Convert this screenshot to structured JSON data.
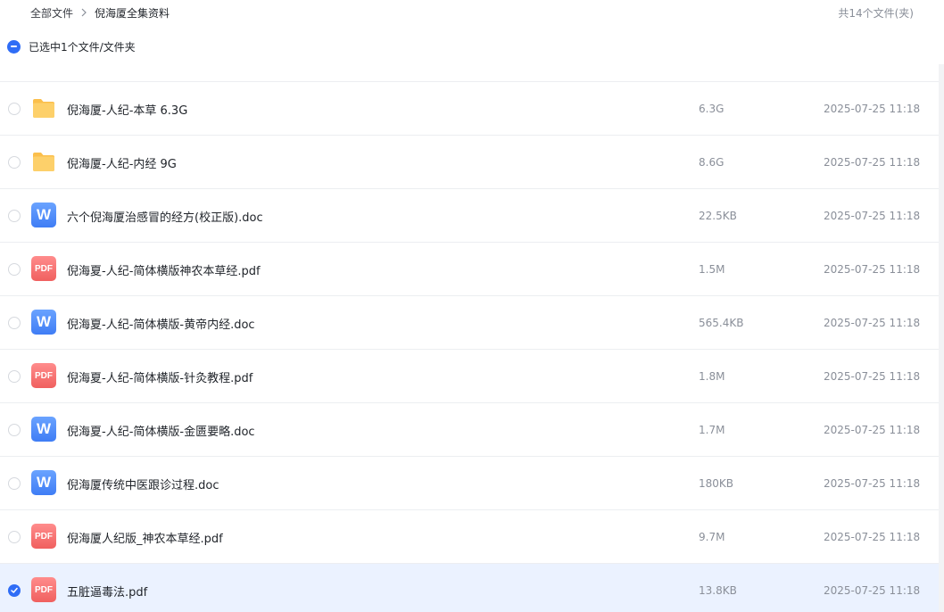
{
  "header": {
    "breadcrumb_root": "全部文件",
    "breadcrumb_current": "倪海厦全集资料",
    "file_count": "共14个文件(夹)",
    "selected_text": "已选中1个文件/文件夹"
  },
  "files": [
    {
      "type": "folder",
      "name": "",
      "size": "",
      "date": "",
      "checked": false
    },
    {
      "type": "folder",
      "name": "倪海厦-人纪-本草 6.3G",
      "size": "6.3G",
      "date": "2025-07-25 11:18",
      "checked": false
    },
    {
      "type": "folder",
      "name": "倪海厦-人纪-内经 9G",
      "size": "8.6G",
      "date": "2025-07-25 11:18",
      "checked": false
    },
    {
      "type": "word",
      "icon_label": "W",
      "name": "六个倪海厦治感冒的经方(校正版).doc",
      "size": "22.5KB",
      "date": "2025-07-25 11:18",
      "checked": false
    },
    {
      "type": "pdf",
      "icon_label": "PDF",
      "name": "倪海夏-人纪-简体横版神农本草经.pdf",
      "size": "1.5M",
      "date": "2025-07-25 11:18",
      "checked": false
    },
    {
      "type": "word",
      "icon_label": "W",
      "name": "倪海夏-人纪-简体横版-黄帝内经.doc",
      "size": "565.4KB",
      "date": "2025-07-25 11:18",
      "checked": false
    },
    {
      "type": "pdf",
      "icon_label": "PDF",
      "name": "倪海夏-人纪-简体横版-针灸教程.pdf",
      "size": "1.8M",
      "date": "2025-07-25 11:18",
      "checked": false
    },
    {
      "type": "word",
      "icon_label": "W",
      "name": "倪海夏-人纪-简体横版-金匮要略.doc",
      "size": "1.7M",
      "date": "2025-07-25 11:18",
      "checked": false
    },
    {
      "type": "word",
      "icon_label": "W",
      "name": "倪海厦传统中医跟诊过程.doc",
      "size": "180KB",
      "date": "2025-07-25 11:18",
      "checked": false
    },
    {
      "type": "pdf",
      "icon_label": "PDF",
      "name": "倪海厦人纪版_神农本草经.pdf",
      "size": "9.7M",
      "date": "2025-07-25 11:18",
      "checked": false
    },
    {
      "type": "pdf",
      "icon_label": "PDF",
      "name": "五脏逼毒法.pdf",
      "size": "13.8KB",
      "date": "2025-07-25 11:18",
      "checked": true
    }
  ],
  "colors": {
    "accent": "#2f6df6",
    "selected_row": "#ebf2ff",
    "folder": "#fcc85b",
    "word": "#3f7df5",
    "pdf": "#f0605f"
  }
}
